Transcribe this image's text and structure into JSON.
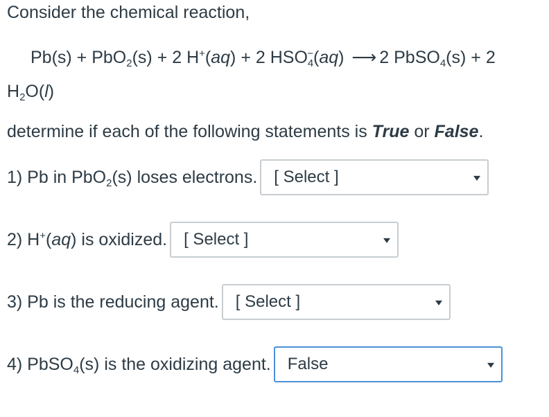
{
  "intro": "Consider the chemical reaction,",
  "equation": {
    "r1": "Pb(s) + PbO",
    "r1_sub": "2",
    "r2": "(s) + 2 H",
    "r2_sup": "+",
    "r3": "(",
    "r3_it": "aq",
    "r4": ") + 2 HSO",
    "r4_sub": "4",
    "r4_sup": "−",
    "r5": "(",
    "r5_it": "aq",
    "r6": ")",
    "arrow": "⟶",
    "p1": "2 PbSO",
    "p1_sub": "4",
    "p2": "(s) + 2",
    "l2a": "H",
    "l2a_sub": "2",
    "l2b": "O(",
    "l2b_it": "l",
    "l2c": ")"
  },
  "instruction": {
    "before": "determine if each of the following statements is ",
    "true_word": "True",
    "or": " or ",
    "false_word": "False",
    "after": "."
  },
  "questions": [
    {
      "a": "1) Pb in PbO",
      "sub": "2",
      "b": "(s) loses electrons.",
      "selected": "[ Select ]"
    },
    {
      "a": "2) H",
      "sup": "+",
      "b": "(",
      "it": "aq",
      "c": ") is oxidized.",
      "selected": "[ Select ]"
    },
    {
      "a": "3) Pb is the reducing agent.",
      "selected": "[ Select ]"
    },
    {
      "a": "4) PbSO",
      "sub": "4",
      "b": "(s) is the oxidizing agent.",
      "selected": "False"
    }
  ],
  "colors": {
    "text": "#2d3b45",
    "select_border": "#c7cdd1",
    "focus_border": "#4a90d9"
  },
  "icons": {
    "dropdown": "caret-down-icon"
  }
}
